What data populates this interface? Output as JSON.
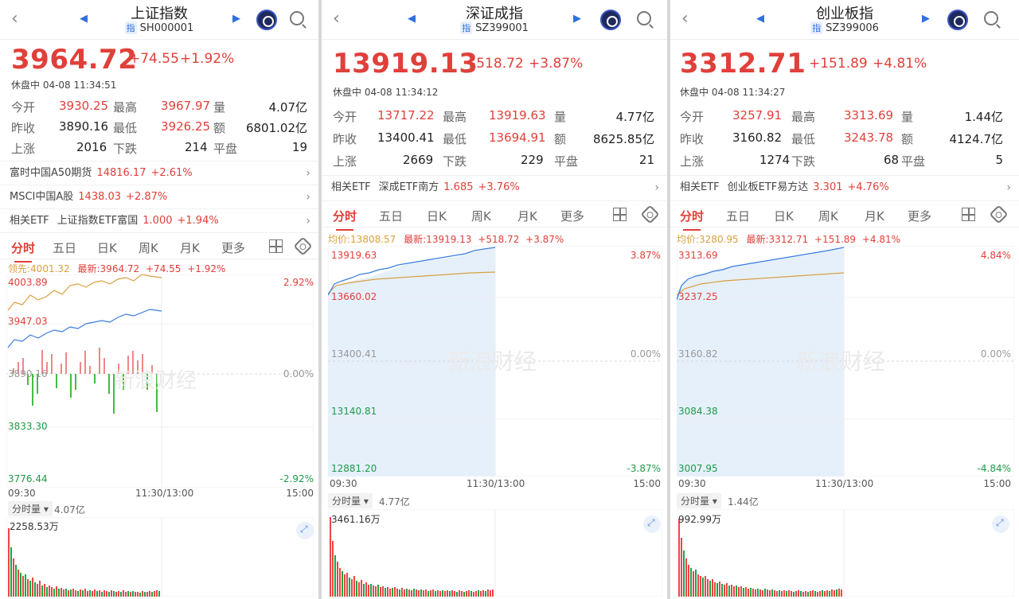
{
  "panels": [
    {
      "title": "上证指数",
      "code": "SH000001",
      "tag": "指",
      "price": "3964.72",
      "change": "+74.55",
      "pct": "+1.92%",
      "status": "休盘中 04-08 11:34:51",
      "stats": {
        "open_label": "今开",
        "open": "3930.25",
        "high_label": "最高",
        "high": "3967.97",
        "vol_label": "量",
        "vol": "4.07亿",
        "prev_label": "昨收",
        "prev": "3890.16",
        "low_label": "最低",
        "low": "3926.25",
        "amt_label": "额",
        "amt": "6801.02亿",
        "up_label": "上涨",
        "up": "2016",
        "down_label": "下跌",
        "down": "214",
        "flat_label": "平盘",
        "flat": "19"
      },
      "rows": [
        {
          "label": "富时中国A50期货",
          "value": "14816.17",
          "pct": "+2.61%"
        },
        {
          "label": "MSCI中国A股",
          "value": "1438.03",
          "pct": "+2.87%"
        },
        {
          "label": "相关ETF",
          "name": "上证指数ETF富国",
          "value": "1.000",
          "pct": "+1.94%"
        }
      ],
      "tabs": [
        "分时",
        "五日",
        "日K",
        "周K",
        "月K",
        "更多"
      ],
      "legend": {
        "avg_label": "领先:4001.32",
        "latest": "最新:3964.72",
        "chg": "+74.55",
        "pct": "+1.92%"
      },
      "yaxis": {
        "top": "4003.89",
        "mid_up": "3947.03",
        "mid": "3890.16",
        "mid_dn": "3833.30",
        "bottom": "3776.44",
        "pct_top": "2.92%",
        "pct_mid": "0.00%",
        "pct_bot": "-2.92%"
      },
      "xaxis": {
        "start": "09:30",
        "mid": "11:30/13:00",
        "end": "15:00"
      },
      "vol_pill": "分时量",
      "vol_total": "4.07亿",
      "vol_max": "2258.53万",
      "watermark": "新浪财经"
    },
    {
      "title": "深证成指",
      "code": "SZ399001",
      "tag": "指",
      "price": "13919.13",
      "change": "+518.72",
      "pct": "+3.87%",
      "status": "休盘中 04-08 11:34:12",
      "stats": {
        "open_label": "今开",
        "open": "13717.22",
        "high_label": "最高",
        "high": "13919.63",
        "vol_label": "量",
        "vol": "4.77亿",
        "prev_label": "昨收",
        "prev": "13400.41",
        "low_label": "最低",
        "low": "13694.91",
        "amt_label": "额",
        "amt": "8625.85亿",
        "up_label": "上涨",
        "up": "2669",
        "down_label": "下跌",
        "down": "229",
        "flat_label": "平盘",
        "flat": "21"
      },
      "rows": [
        {
          "label": "相关ETF",
          "name": "深成ETF南方",
          "value": "1.685",
          "pct": "+3.76%"
        }
      ],
      "tabs": [
        "分时",
        "五日",
        "日K",
        "周K",
        "月K",
        "更多"
      ],
      "legend": {
        "avg_label": "均价:13808.57",
        "latest": "最新:13919.13",
        "chg": "+518.72",
        "pct": "+3.87%"
      },
      "yaxis": {
        "top": "13919.63",
        "mid_up": "13660.02",
        "mid": "13400.41",
        "mid_dn": "13140.81",
        "bottom": "12881.20",
        "pct_top": "3.87%",
        "pct_mid": "0.00%",
        "pct_bot": "-3.87%"
      },
      "xaxis": {
        "start": "09:30",
        "mid": "11:30/13:00",
        "end": "15:00"
      },
      "vol_pill": "分时量",
      "vol_total": "4.77亿",
      "vol_max": "3461.16万",
      "watermark": "新浪财经"
    },
    {
      "title": "创业板指",
      "code": "SZ399006",
      "tag": "指",
      "price": "3312.71",
      "change": "+151.89",
      "pct": "+4.81%",
      "status": "休盘中 04-08 11:34:27",
      "stats": {
        "open_label": "今开",
        "open": "3257.91",
        "high_label": "最高",
        "high": "3313.69",
        "vol_label": "量",
        "vol": "1.44亿",
        "prev_label": "昨收",
        "prev": "3160.82",
        "low_label": "最低",
        "low": "3243.78",
        "amt_label": "额",
        "amt": "4124.7亿",
        "up_label": "上涨",
        "up": "1274",
        "down_label": "下跌",
        "down": "68",
        "flat_label": "平盘",
        "flat": "5"
      },
      "rows": [
        {
          "label": "相关ETF",
          "name": "创业板ETF易方达",
          "value": "3.301",
          "pct": "+4.76%"
        }
      ],
      "tabs": [
        "分时",
        "五日",
        "日K",
        "周K",
        "月K",
        "更多"
      ],
      "legend": {
        "avg_label": "均价:3280.95",
        "latest": "最新:3312.71",
        "chg": "+151.89",
        "pct": "+4.81%"
      },
      "yaxis": {
        "top": "3313.69",
        "mid_up": "3237.25",
        "mid": "3160.82",
        "mid_dn": "3084.38",
        "bottom": "3007.95",
        "pct_top": "4.84%",
        "pct_mid": "0.00%",
        "pct_bot": "-4.84%"
      },
      "xaxis": {
        "start": "09:30",
        "mid": "11:30/13:00",
        "end": "15:00"
      },
      "vol_pill": "分时量",
      "vol_total": "1.44亿",
      "vol_max": "992.99万",
      "watermark": "新浪财经"
    }
  ],
  "colors": {
    "up": "#e0403a",
    "down": "#1f9a4a",
    "line": "#3b7ddd",
    "avg": "#d9a040",
    "accent": "#2f6fe0"
  }
}
